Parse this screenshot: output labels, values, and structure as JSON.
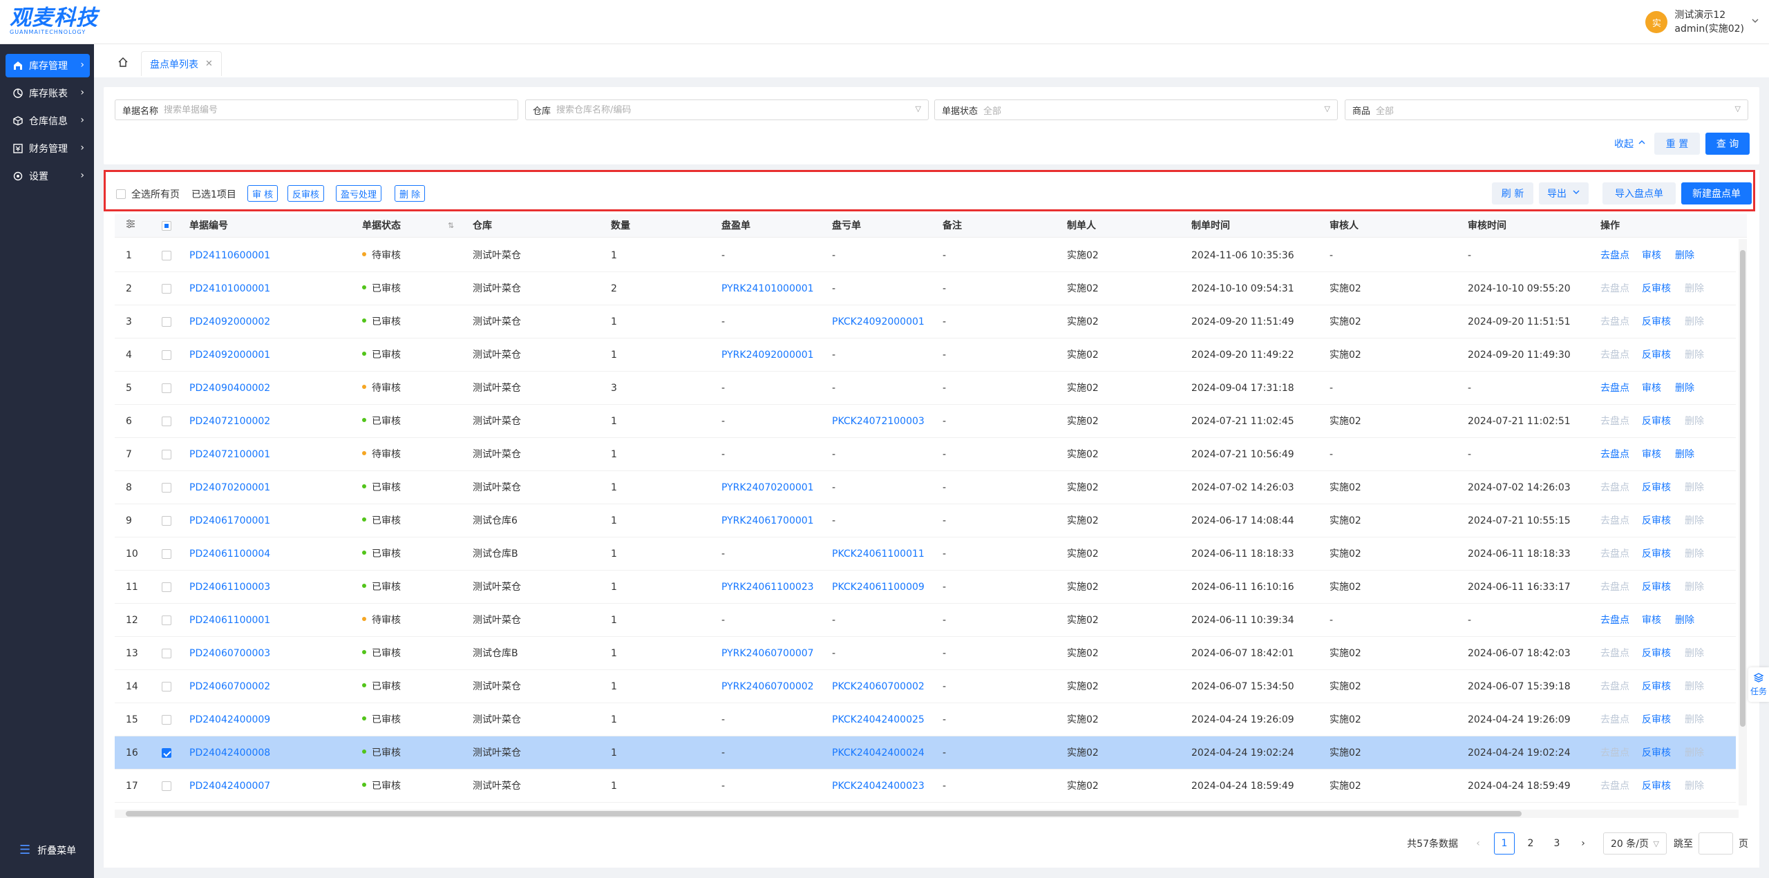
{
  "app": {
    "logo_text": "观麦科技",
    "logo_sub": "GUANMAITECHNOLOGY"
  },
  "user": {
    "avatar": "实",
    "name": "测试演示12",
    "account": "admin(实施02)"
  },
  "sidebar": {
    "items": [
      {
        "label": "库存管理",
        "icon": "warehouse-icon",
        "active": true
      },
      {
        "label": "库存账表",
        "icon": "chart-icon"
      },
      {
        "label": "仓库信息",
        "icon": "cube-icon"
      },
      {
        "label": "财务管理",
        "icon": "finance-icon"
      },
      {
        "label": "设置",
        "icon": "gear-icon"
      }
    ],
    "collapse_label": "折叠菜单"
  },
  "tabs": {
    "active_label": "盘点单列表"
  },
  "filters": {
    "doc_name_label": "单据名称",
    "doc_name_placeholder": "搜索单据编号",
    "warehouse_label": "仓库",
    "warehouse_placeholder": "搜索仓库名称/编码",
    "status_label": "单据状态",
    "status_value": "全部",
    "goods_label": "商品",
    "goods_value": "全部",
    "collapse_label": "收起",
    "reset_label": "重 置",
    "query_label": "查 询"
  },
  "toolbar": {
    "select_all_label": "全选所有页",
    "selected_text": "已选1项目",
    "audit_label": "审 核",
    "unaudit_label": "反审核",
    "loss_label": "盈亏处理",
    "delete_label": "删 除",
    "refresh_label": "刷 新",
    "export_label": "导出",
    "import_label": "导入盘点单",
    "new_label": "新建盘点单"
  },
  "table": {
    "columns": [
      "单据编号",
      "单据状态",
      "仓库",
      "数量",
      "盘盈单",
      "盘亏单",
      "备注",
      "制单人",
      "制单时间",
      "审核人",
      "审核时间",
      "操作"
    ],
    "rows": [
      {
        "idx": "1",
        "code": "PD24110600001",
        "status": "待审核",
        "warehouse": "测试叶菜仓",
        "qty": "1",
        "gain": "-",
        "loss": "-",
        "note": "-",
        "maker": "实施02",
        "made": "2024-11-06 10:35:36",
        "auditor": "-",
        "audited": "-",
        "ops": [
          "去盘点",
          "审核",
          "删除"
        ],
        "pending": true
      },
      {
        "idx": "2",
        "code": "PD24101000001",
        "status": "已审核",
        "warehouse": "测试叶菜仓",
        "qty": "2",
        "gain": "PYRK24101000001",
        "loss": "-",
        "note": "-",
        "maker": "实施02",
        "made": "2024-10-10 09:54:31",
        "auditor": "实施02",
        "audited": "2024-10-10 09:55:20",
        "ops": [
          "去盘点",
          "反审核",
          "删除"
        ]
      },
      {
        "idx": "3",
        "code": "PD24092000002",
        "status": "已审核",
        "warehouse": "测试叶菜仓",
        "qty": "1",
        "gain": "-",
        "loss": "PKCK24092000001",
        "note": "-",
        "maker": "实施02",
        "made": "2024-09-20 11:51:49",
        "auditor": "实施02",
        "audited": "2024-09-20 11:51:51",
        "ops": [
          "去盘点",
          "反审核",
          "删除"
        ]
      },
      {
        "idx": "4",
        "code": "PD24092000001",
        "status": "已审核",
        "warehouse": "测试叶菜仓",
        "qty": "1",
        "gain": "PYRK24092000001",
        "loss": "-",
        "note": "-",
        "maker": "实施02",
        "made": "2024-09-20 11:49:22",
        "auditor": "实施02",
        "audited": "2024-09-20 11:49:30",
        "ops": [
          "去盘点",
          "反审核",
          "删除"
        ]
      },
      {
        "idx": "5",
        "code": "PD24090400002",
        "status": "待审核",
        "warehouse": "测试叶菜仓",
        "qty": "3",
        "gain": "-",
        "loss": "-",
        "note": "-",
        "maker": "实施02",
        "made": "2024-09-04 17:31:18",
        "auditor": "-",
        "audited": "-",
        "ops": [
          "去盘点",
          "审核",
          "删除"
        ],
        "pending": true
      },
      {
        "idx": "6",
        "code": "PD24072100002",
        "status": "已审核",
        "warehouse": "测试叶菜仓",
        "qty": "1",
        "gain": "-",
        "loss": "PKCK24072100003",
        "note": "-",
        "maker": "实施02",
        "made": "2024-07-21 11:02:45",
        "auditor": "实施02",
        "audited": "2024-07-21 11:02:51",
        "ops": [
          "去盘点",
          "反审核",
          "删除"
        ]
      },
      {
        "idx": "7",
        "code": "PD24072100001",
        "status": "待审核",
        "warehouse": "测试叶菜仓",
        "qty": "1",
        "gain": "-",
        "loss": "-",
        "note": "-",
        "maker": "实施02",
        "made": "2024-07-21 10:56:49",
        "auditor": "-",
        "audited": "-",
        "ops": [
          "去盘点",
          "审核",
          "删除"
        ],
        "pending": true
      },
      {
        "idx": "8",
        "code": "PD24070200001",
        "status": "已审核",
        "warehouse": "测试叶菜仓",
        "qty": "1",
        "gain": "PYRK24070200001",
        "loss": "-",
        "note": "-",
        "maker": "实施02",
        "made": "2024-07-02 14:26:03",
        "auditor": "实施02",
        "audited": "2024-07-02 14:26:03",
        "ops": [
          "去盘点",
          "反审核",
          "删除"
        ]
      },
      {
        "idx": "9",
        "code": "PD24061700001",
        "status": "已审核",
        "warehouse": "测试仓库6",
        "qty": "1",
        "gain": "PYRK24061700001",
        "loss": "-",
        "note": "-",
        "maker": "实施02",
        "made": "2024-06-17 14:08:44",
        "auditor": "实施02",
        "audited": "2024-07-21 10:55:15",
        "ops": [
          "去盘点",
          "反审核",
          "删除"
        ]
      },
      {
        "idx": "10",
        "code": "PD24061100004",
        "status": "已审核",
        "warehouse": "测试仓库B",
        "qty": "1",
        "gain": "-",
        "loss": "PKCK24061100011",
        "note": "-",
        "maker": "实施02",
        "made": "2024-06-11 18:18:33",
        "auditor": "实施02",
        "audited": "2024-06-11 18:18:33",
        "ops": [
          "去盘点",
          "反审核",
          "删除"
        ]
      },
      {
        "idx": "11",
        "code": "PD24061100003",
        "status": "已审核",
        "warehouse": "测试叶菜仓",
        "qty": "1",
        "gain": "PYRK24061100023",
        "loss": "PKCK24061100009",
        "note": "-",
        "maker": "实施02",
        "made": "2024-06-11 16:10:16",
        "auditor": "实施02",
        "audited": "2024-06-11 16:33:17",
        "ops": [
          "去盘点",
          "反审核",
          "删除"
        ]
      },
      {
        "idx": "12",
        "code": "PD24061100001",
        "status": "待审核",
        "warehouse": "测试叶菜仓",
        "qty": "1",
        "gain": "-",
        "loss": "-",
        "note": "-",
        "maker": "实施02",
        "made": "2024-06-11 10:39:34",
        "auditor": "-",
        "audited": "-",
        "ops": [
          "去盘点",
          "审核",
          "删除"
        ],
        "pending": true
      },
      {
        "idx": "13",
        "code": "PD24060700003",
        "status": "已审核",
        "warehouse": "测试仓库B",
        "qty": "1",
        "gain": "PYRK24060700007",
        "loss": "-",
        "note": "-",
        "maker": "实施02",
        "made": "2024-06-07 18:42:01",
        "auditor": "实施02",
        "audited": "2024-06-07 18:42:03",
        "ops": [
          "去盘点",
          "反审核",
          "删除"
        ]
      },
      {
        "idx": "14",
        "code": "PD24060700002",
        "status": "已审核",
        "warehouse": "测试叶菜仓",
        "qty": "1",
        "gain": "PYRK24060700002",
        "loss": "PKCK24060700002",
        "note": "-",
        "maker": "实施02",
        "made": "2024-06-07 15:34:50",
        "auditor": "实施02",
        "audited": "2024-06-07 15:39:18",
        "ops": [
          "去盘点",
          "反审核",
          "删除"
        ]
      },
      {
        "idx": "15",
        "code": "PD24042400009",
        "status": "已审核",
        "warehouse": "测试叶菜仓",
        "qty": "1",
        "gain": "-",
        "loss": "PKCK24042400025",
        "note": "-",
        "maker": "实施02",
        "made": "2024-04-24 19:26:09",
        "auditor": "实施02",
        "audited": "2024-04-24 19:26:09",
        "ops": [
          "去盘点",
          "反审核",
          "删除"
        ]
      },
      {
        "idx": "16",
        "code": "PD24042400008",
        "status": "已审核",
        "warehouse": "测试叶菜仓",
        "qty": "1",
        "gain": "-",
        "loss": "PKCK24042400024",
        "note": "-",
        "maker": "实施02",
        "made": "2024-04-24 19:02:24",
        "auditor": "实施02",
        "audited": "2024-04-24 19:02:24",
        "ops": [
          "去盘点",
          "反审核",
          "删除"
        ],
        "selected": true
      },
      {
        "idx": "17",
        "code": "PD24042400007",
        "status": "已审核",
        "warehouse": "测试叶菜仓",
        "qty": "1",
        "gain": "-",
        "loss": "PKCK24042400023",
        "note": "-",
        "maker": "实施02",
        "made": "2024-04-24 18:59:49",
        "auditor": "实施02",
        "audited": "2024-04-24 18:59:49",
        "ops": [
          "去盘点",
          "反审核",
          "删除"
        ]
      }
    ]
  },
  "pagination": {
    "total_text": "共57条数据",
    "pages": [
      "1",
      "2",
      "3"
    ],
    "current": "1",
    "page_size": "20 条/页",
    "goto_label": "跳至",
    "page_unit": "页"
  },
  "float": {
    "task_label": "任务"
  },
  "colors": {
    "primary": "#1677ff",
    "pending_dot": "#f5a623",
    "approved_dot": "#52c41a",
    "sidebar_bg": "#252b3d",
    "highlight_border": "#e83030"
  }
}
